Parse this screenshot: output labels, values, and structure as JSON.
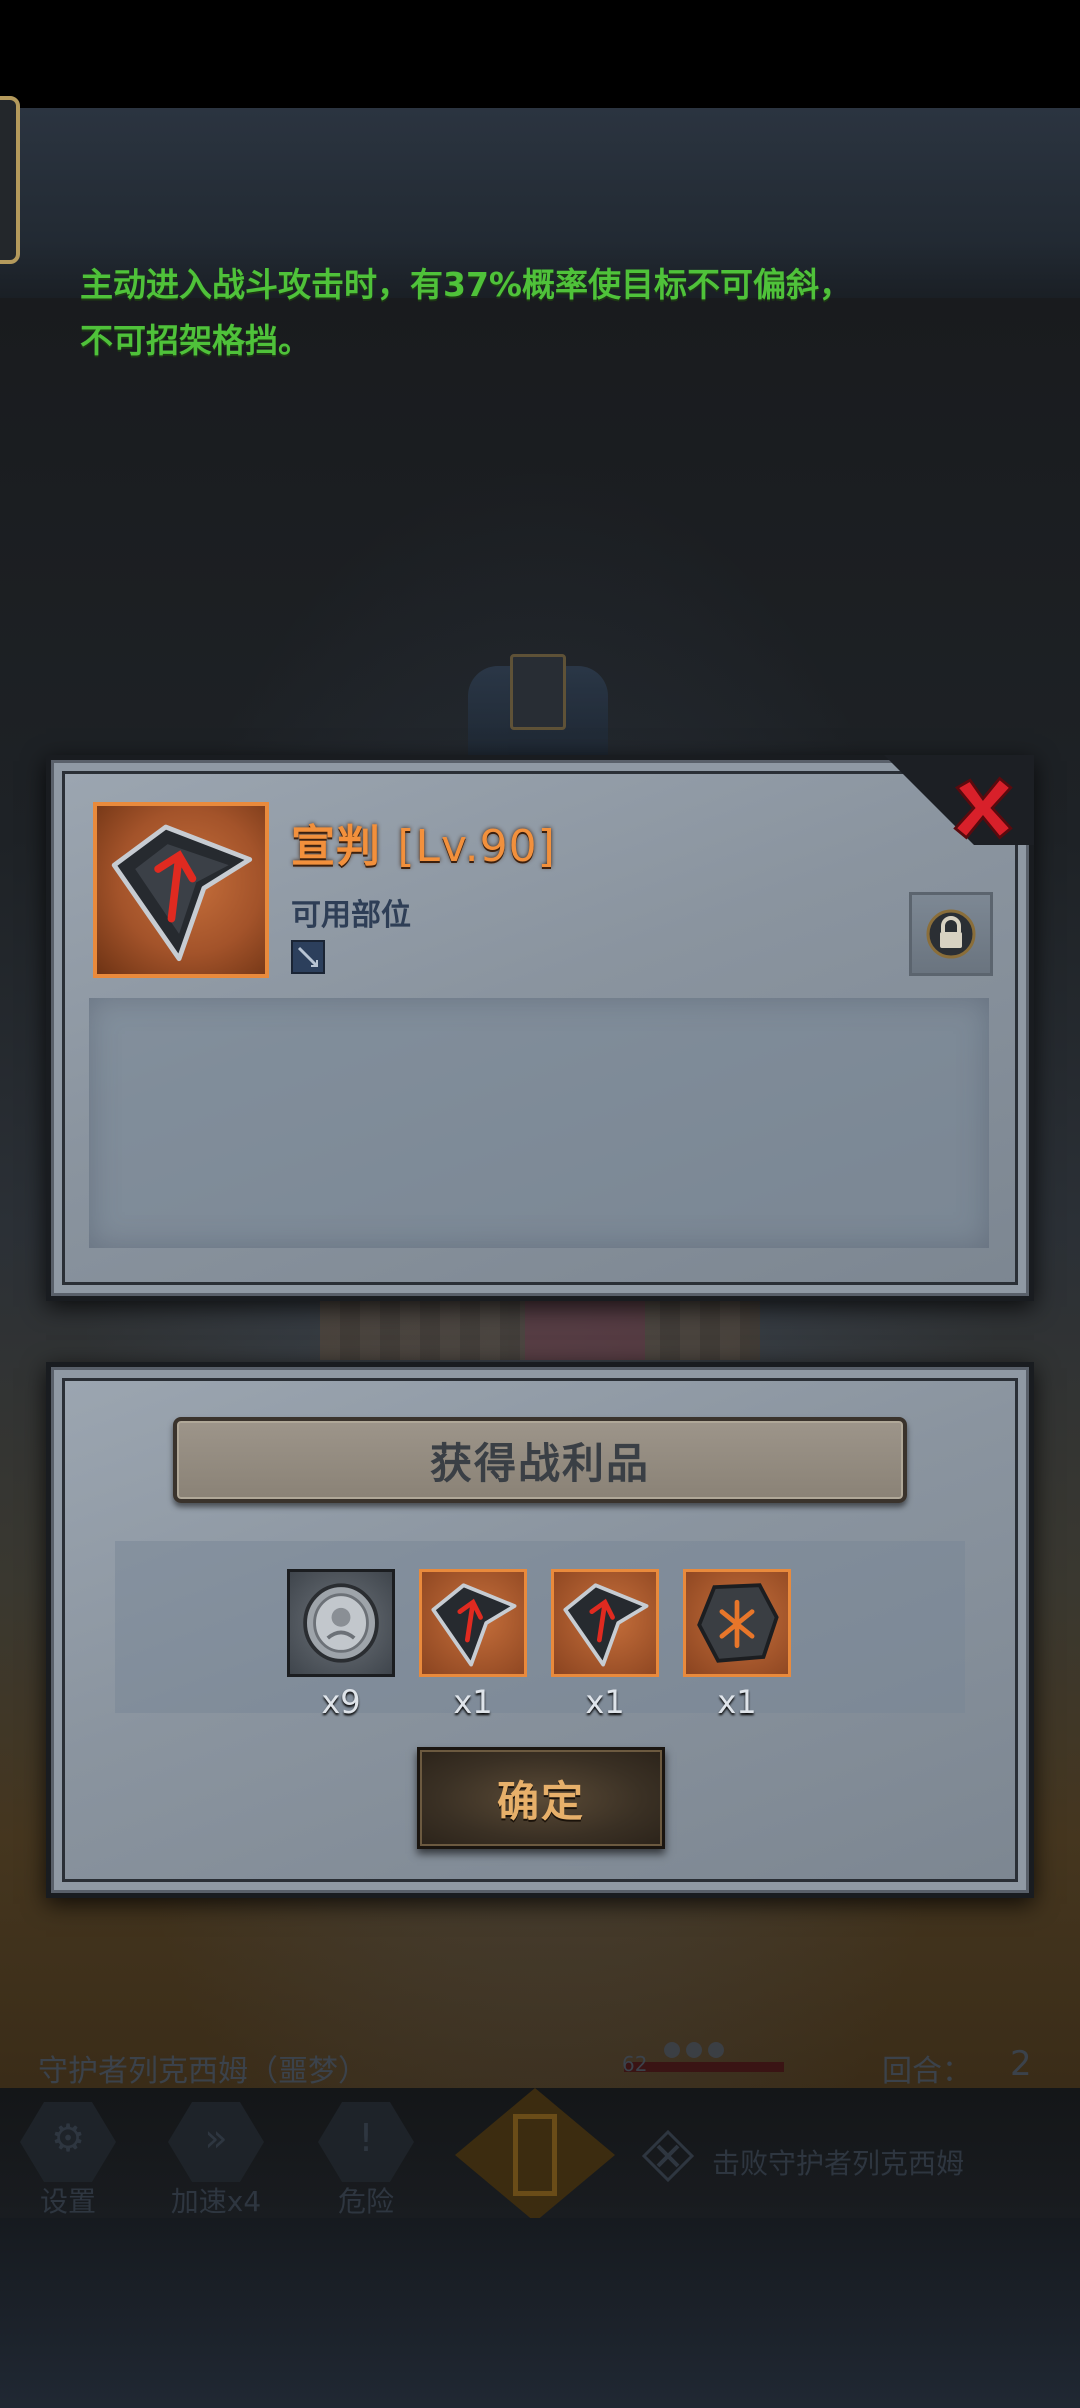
{
  "item": {
    "name": "宣判",
    "level": "[Lv.90]",
    "slot_label": "可用部位",
    "description_line1": "主动进入战斗攻击时，有37%概率使目标不可偏斜，",
    "description_line2": "不可招架格挡。"
  },
  "loot": {
    "title": "获得战利品",
    "items": [
      {
        "icon": "silver-coin-icon",
        "count": "x9"
      },
      {
        "icon": "verdict-shard-icon",
        "count": "x1"
      },
      {
        "icon": "verdict-shard-icon",
        "count": "x1"
      },
      {
        "icon": "rune-stone-icon",
        "count": "x1"
      }
    ],
    "confirm_label": "确定"
  },
  "battle": {
    "boss_name": "守护者列克西姆（噩梦）",
    "hp_value": "62",
    "round_label": "回合：",
    "round_value": "2"
  },
  "hud": {
    "settings_label": "设置",
    "speed_label": "加速x4",
    "danger_label": "危险",
    "objective": "击败守护者列克西姆"
  },
  "colors": {
    "item_name": "#f2903c",
    "description": "#4fc23a",
    "close_x": "#d8202a",
    "rarity_border": "#e98a3c"
  }
}
